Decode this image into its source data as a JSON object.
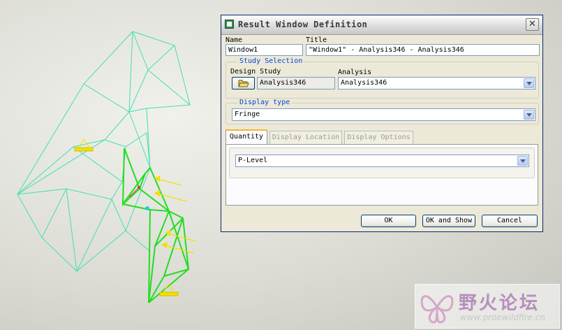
{
  "dialog": {
    "title": "Result Window Definition",
    "close_glyph": "✕",
    "name_label": "Name",
    "name_value": "Window1",
    "title_label": "Title",
    "title_value": "\"Window1\" - Analysis346 - Analysis346",
    "study_selection": {
      "group_label": "Study Selection",
      "design_study_label": "Design Study",
      "design_study_value": "Analysis346",
      "analysis_label": "Analysis",
      "analysis_value": "Analysis346",
      "open_icon": "folder-open-icon"
    },
    "display_type": {
      "group_label": "Display type",
      "value": "Fringe"
    },
    "tabs": [
      {
        "label": "Quantity",
        "active": true
      },
      {
        "label": "Display Location",
        "active": false
      },
      {
        "label": "Display Options",
        "active": false
      }
    ],
    "quantity_value": "P-Level",
    "buttons": {
      "ok": "OK",
      "ok_and_show": "OK and Show",
      "cancel": "Cancel"
    }
  },
  "watermark": {
    "chinese": "野火论坛",
    "url": "www.proewildfire.cn",
    "logo_icon": "butterfly-logo-icon"
  },
  "colors": {
    "mesh_cyan": "#40e0b0",
    "mesh_green": "#22dd22",
    "load_yellow": "#f0e000",
    "title_accent": "#0046d5"
  }
}
